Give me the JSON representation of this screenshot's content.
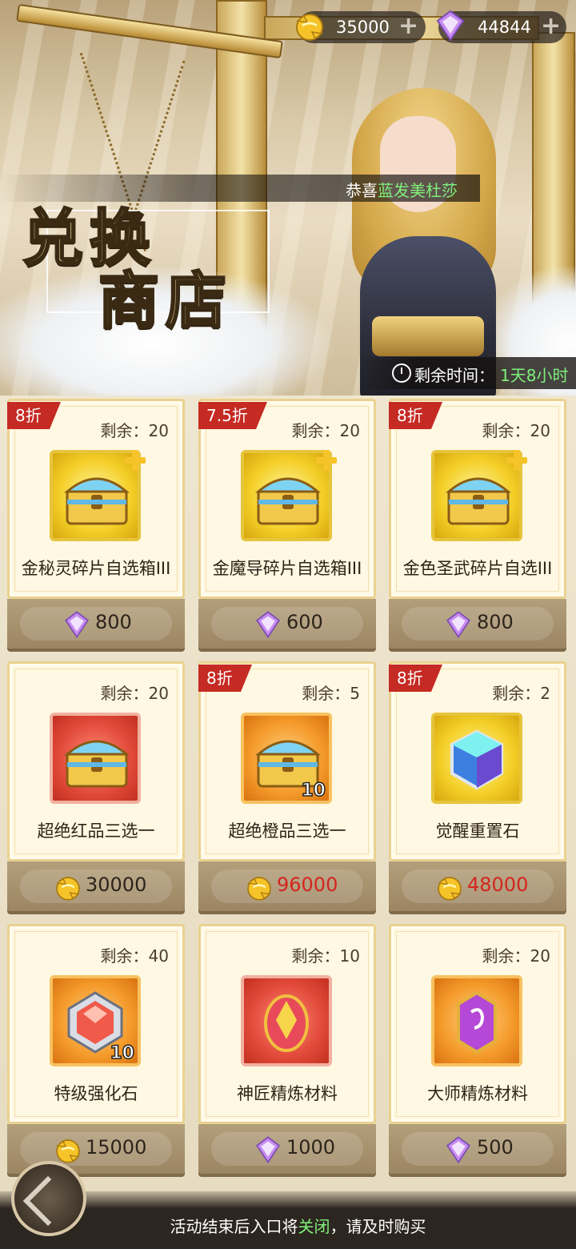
{
  "currency": {
    "gold": {
      "value": "35000",
      "icon": "gold-coin-icon"
    },
    "diamond": {
      "value": "44844",
      "icon": "diamond-icon"
    },
    "plus_symbol": "+"
  },
  "banner": {
    "congrats_prefix": "恭喜",
    "congrats_name": "蓝发美杜莎",
    "title_line1": "兑换",
    "title_line2": "商店",
    "timer_label": "剩余时间：",
    "timer_value": "1天8小时"
  },
  "items": [
    {
      "discount": "8折",
      "remain": "剩余：20",
      "name": "金秘灵碎片自选箱III",
      "price": "800",
      "price_currency": "diamond",
      "qty": ""
    },
    {
      "discount": "7.5折",
      "remain": "剩余：20",
      "name": "金魔导碎片自选箱III",
      "price": "600",
      "price_currency": "diamond",
      "qty": ""
    },
    {
      "discount": "8折",
      "remain": "剩余：20",
      "name": "金色圣武碎片自选III",
      "price": "800",
      "price_currency": "diamond",
      "qty": ""
    },
    {
      "discount": "",
      "remain": "剩余：20",
      "name": "超绝红品三选一",
      "price": "30000",
      "price_currency": "gold",
      "qty": ""
    },
    {
      "discount": "8折",
      "remain": "剩余：5",
      "name": "超绝橙品三选一",
      "price": "96000",
      "price_currency": "gold",
      "qty": "10"
    },
    {
      "discount": "8折",
      "remain": "剩余：2",
      "name": "觉醒重置石",
      "price": "48000",
      "price_currency": "gold",
      "qty": ""
    },
    {
      "discount": "",
      "remain": "剩余：40",
      "name": "特级强化石",
      "price": "15000",
      "price_currency": "gold",
      "qty": "10"
    },
    {
      "discount": "",
      "remain": "剩余：10",
      "name": "神匠精炼材料",
      "price": "1000",
      "price_currency": "diamond",
      "qty": ""
    },
    {
      "discount": "",
      "remain": "剩余：20",
      "name": "大师精炼材料",
      "price": "500",
      "price_currency": "diamond",
      "qty": ""
    }
  ],
  "colors": {
    "discount_red": "#c52a23",
    "highlight_green": "#7ff07a",
    "price_red": "#d3261e"
  },
  "footer": {
    "note_prefix": "活动结束后入口将",
    "note_highlight": "关闭",
    "note_suffix": "，请及时购买"
  }
}
